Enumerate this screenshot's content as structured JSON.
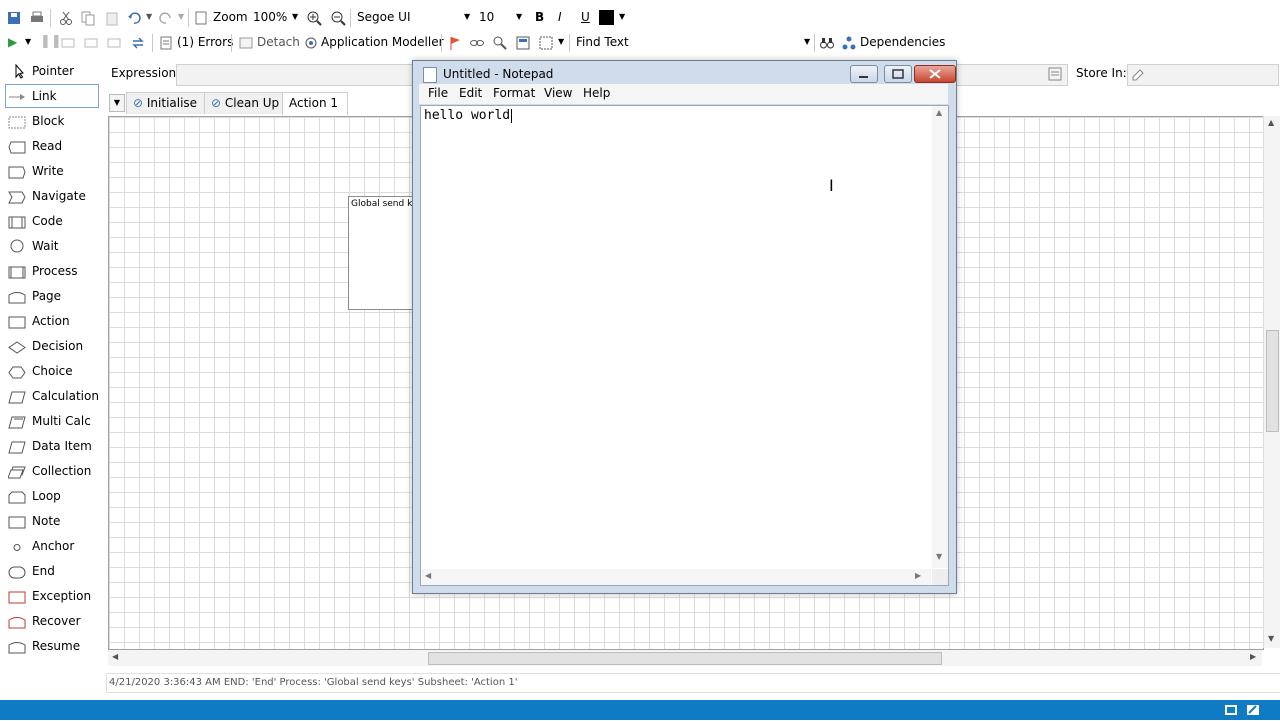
{
  "toolbar1": {
    "zoom_label": "Zoom",
    "zoom_value": "100%",
    "font_name": "Segoe UI",
    "font_size": "10",
    "bold": "B",
    "italic": "I",
    "underline": "U"
  },
  "toolbar2": {
    "errors": "(1) Errors",
    "detach": "Detach",
    "app_modeller": "Application Modeller",
    "find_text": "Find Text",
    "dependencies": "Dependencies"
  },
  "palette": {
    "items": [
      {
        "label": "Pointer"
      },
      {
        "label": "Link"
      },
      {
        "label": "Block"
      },
      {
        "label": "Read"
      },
      {
        "label": "Write"
      },
      {
        "label": "Navigate"
      },
      {
        "label": "Code"
      },
      {
        "label": "Wait"
      },
      {
        "label": "Process"
      },
      {
        "label": "Page"
      },
      {
        "label": "Action"
      },
      {
        "label": "Decision"
      },
      {
        "label": "Choice"
      },
      {
        "label": "Calculation"
      },
      {
        "label": "Multi Calc"
      },
      {
        "label": "Data Item"
      },
      {
        "label": "Collection"
      },
      {
        "label": "Loop"
      },
      {
        "label": "Note"
      },
      {
        "label": "Anchor"
      },
      {
        "label": "End"
      },
      {
        "label": "Exception"
      },
      {
        "label": "Recover"
      },
      {
        "label": "Resume"
      }
    ]
  },
  "expression": {
    "label": "Expression:",
    "store_in_label": "Store In:"
  },
  "tabs": [
    {
      "label": "Initialise"
    },
    {
      "label": "Clean Up"
    },
    {
      "label": "Action 1"
    }
  ],
  "canvas": {
    "stage_label": "Global send k"
  },
  "notepad": {
    "title": "Untitled - Notepad",
    "menu": [
      "File",
      "Edit",
      "Format",
      "View",
      "Help"
    ],
    "content": "hello world"
  },
  "status": {
    "text": "4/21/2020 3:36:43 AM END: 'End' Process: 'Global send keys' Subsheet: 'Action 1'"
  },
  "colors": {
    "taskbar": "#0f7bc4",
    "selection": "#7ea7d8"
  }
}
